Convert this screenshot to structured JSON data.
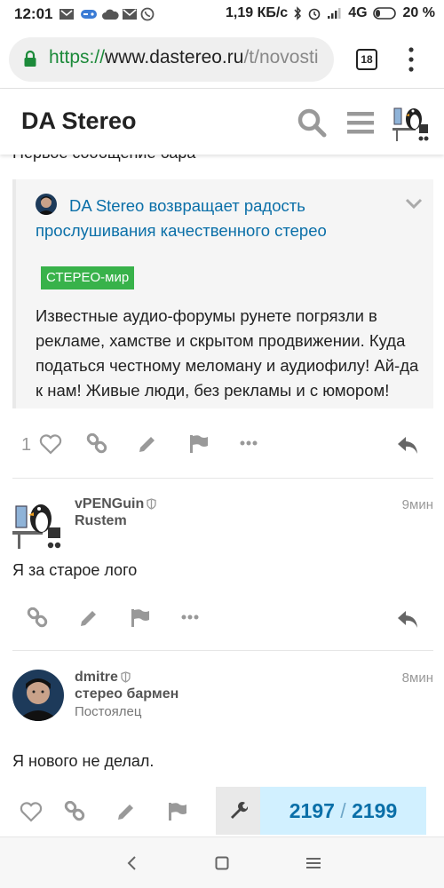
{
  "status_bar": {
    "time": "12:01",
    "net_speed": "1,19 КБ/с",
    "network": "4G",
    "battery": "20 %"
  },
  "browser": {
    "url_scheme": "https://",
    "url_host": "www.dastereo.ru",
    "url_path": "/t/novosti",
    "tab_count": "18"
  },
  "site_header": {
    "logo": "DA Stereo"
  },
  "previous_text": "Первое сообщение бара",
  "onebox": {
    "title": "DA Stereo возвращает радость прослушивания качественного стерео",
    "category": "СТЕРЕО-мир",
    "excerpt": "Известные аудио-форумы рунете погрязли в рекламе, хамстве и скрытом продвижении. Куда податься честному меломану и аудиофилу! Ай-да к нам! Живые люди, без рекламы и с юмором!",
    "like_count": "1"
  },
  "posts": [
    {
      "username": "vPENGuin",
      "title": "Rustem",
      "time": "9мин",
      "body": "Я за старое лого"
    },
    {
      "username": "dmitre",
      "title": "стерео бармен",
      "subtitle": "Постоялец",
      "time": "8мин",
      "body": "Я нового не делал."
    }
  ],
  "progress": {
    "current": "2197",
    "separator": "/",
    "total": "2199"
  },
  "colors": {
    "link": "#0a6fa8",
    "category_badge": "#38b24a",
    "progress_bg": "#d1f0ff",
    "icon_gray": "#999999"
  }
}
